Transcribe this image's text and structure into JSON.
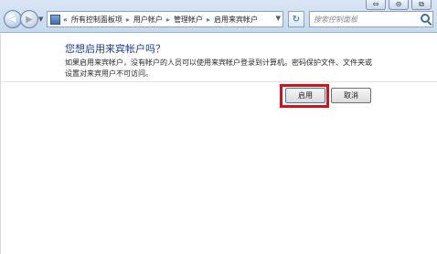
{
  "window": {
    "controls": [
      "⇔",
      "⊖",
      "⧉"
    ]
  },
  "nav": {
    "back_glyph": "◀",
    "forward_glyph": "▶"
  },
  "address_bar": {
    "prefix": "«",
    "crumbs": [
      "所有控制面板项",
      "用户帐户",
      "管理帐户",
      "启用来宾帐户"
    ],
    "separator": "▸"
  },
  "refresh_glyph": "↻",
  "search": {
    "placeholder": "搜索控制面板"
  },
  "page": {
    "heading": "您想启用来宾帐户吗？",
    "description": "如果启用来宾帐户，没有帐户的人员可以使用来宾帐户登录到计算机。密码保护文件、文件夹或设置对来宾用户不可访问。",
    "enable_button": "启用",
    "cancel_button": "取消"
  },
  "colors": {
    "heading": "#1a3f96",
    "highlight": "#d0141e"
  },
  "icons": [
    "back-arrow-icon",
    "forward-arrow-icon",
    "control-panel-icon",
    "refresh-icon",
    "search-icon"
  ]
}
